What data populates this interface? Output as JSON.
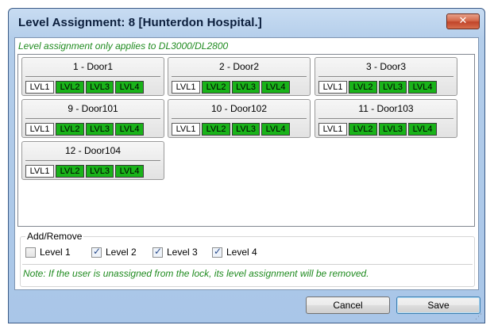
{
  "window": {
    "title": "Level Assignment: 8 [Hunterdon Hospital.]",
    "close_glyph": "✕"
  },
  "notes": {
    "top": "Level assignment only applies to DL3000/DL2800",
    "bottom": "Note: If the user is unassigned from the lock, its level assignment will be removed."
  },
  "level_labels": [
    "LVL1",
    "LVL2",
    "LVL3",
    "LVL4"
  ],
  "doors": [
    {
      "name": "1 - Door1",
      "levels": [
        false,
        true,
        true,
        true
      ]
    },
    {
      "name": "2 - Door2",
      "levels": [
        false,
        true,
        true,
        true
      ]
    },
    {
      "name": "3 - Door3",
      "levels": [
        false,
        true,
        true,
        true
      ]
    },
    {
      "name": "9 - Door101",
      "levels": [
        false,
        true,
        true,
        true
      ]
    },
    {
      "name": "10 - Door102",
      "levels": [
        false,
        true,
        true,
        true
      ]
    },
    {
      "name": "11 - Door103",
      "levels": [
        false,
        true,
        true,
        true
      ]
    },
    {
      "name": "12 - Door104",
      "levels": [
        false,
        true,
        true,
        true
      ]
    }
  ],
  "add_remove": {
    "label": "Add/Remove",
    "options": [
      {
        "label": "Level 1",
        "checked": false
      },
      {
        "label": "Level 2",
        "checked": true
      },
      {
        "label": "Level 3",
        "checked": true
      },
      {
        "label": "Level 4",
        "checked": true
      }
    ]
  },
  "buttons": {
    "cancel": "Cancel",
    "save": "Save"
  },
  "colors": {
    "level_on": "#19b319",
    "level_off": "#ffffff",
    "note_text": "#1f8b1f",
    "close_button": "#c0452a"
  }
}
